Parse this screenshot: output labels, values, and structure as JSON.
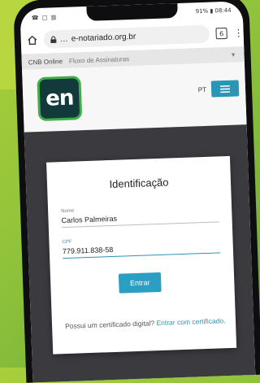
{
  "status_bar": {
    "left": "☎ □ ▥",
    "right": "91% ▮ 08:44"
  },
  "browser": {
    "url": "e-notariado.org.br",
    "url_prefix": "…",
    "tabs_count": "6"
  },
  "site_bar": {
    "brand": "CNB Online",
    "section": "Fluxo de Assinaturas"
  },
  "header": {
    "logo_text": "en",
    "language": "PT"
  },
  "form": {
    "title": "Identificação",
    "name_label": "Nome",
    "name_value": "Carlos Palmeiras",
    "cpf_label": "CPF",
    "cpf_value": "779.911.838-58",
    "submit_label": "Entrar",
    "cert_prompt": "Possui um certificado digital?",
    "cert_link": "Entrar com certificado."
  },
  "colors": {
    "accent": "#2b95b5",
    "logo_bg": "#123a3a",
    "logo_border": "#3fae4a",
    "background": "#8fc23a"
  }
}
